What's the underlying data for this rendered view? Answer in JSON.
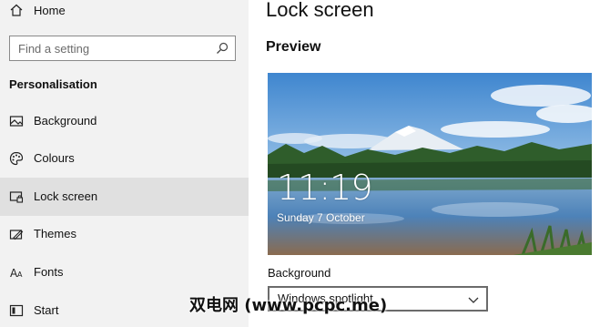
{
  "sidebar": {
    "home_label": "Home",
    "search_placeholder": "Find a setting",
    "section_title": "Personalisation",
    "items": [
      {
        "label": "Background",
        "icon": "image-icon"
      },
      {
        "label": "Colours",
        "icon": "palette-icon"
      },
      {
        "label": "Lock screen",
        "icon": "lock-screen-icon",
        "active": true
      },
      {
        "label": "Themes",
        "icon": "themes-icon"
      },
      {
        "label": "Fonts",
        "icon": "fonts-icon"
      },
      {
        "label": "Start",
        "icon": "start-icon"
      }
    ]
  },
  "main": {
    "title": "Lock screen",
    "preview_heading": "Preview",
    "preview": {
      "time": "11:19",
      "date": "Sunday 7 October"
    },
    "background_label": "Background",
    "background_value": "Windows spotlight"
  },
  "watermark": "双电网 (www.pcpc.me)",
  "colors": {
    "sidebar_bg": "#f2f2f2",
    "active_item_bg": "#e0e0e0",
    "sky": "#4f8fd0",
    "water": "#3f79b8",
    "forest": "#2e5a2a"
  }
}
